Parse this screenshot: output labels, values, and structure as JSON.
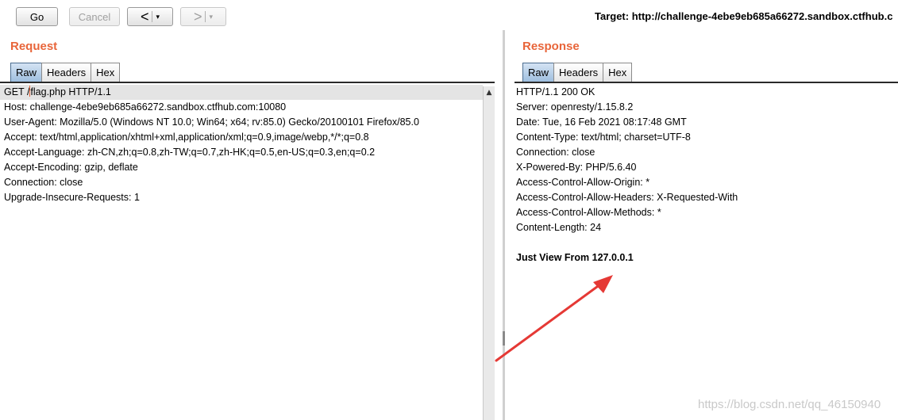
{
  "toolbar": {
    "go_label": "Go",
    "cancel_label": "Cancel",
    "back_glyph": "<",
    "forward_glyph": ">",
    "dropdown_glyph": "▾",
    "target_text": "Target: http://challenge-4ebe9eb685a66272.sandbox.ctfhub.c"
  },
  "request": {
    "title": "Request",
    "tabs": [
      "Raw",
      "Headers",
      "Hex"
    ],
    "active_tab": "Raw",
    "first_line_prefix": "GET /",
    "first_line_suffix": "flag.php HTTP/1.1",
    "lines": [
      "Host: challenge-4ebe9eb685a66272.sandbox.ctfhub.com:10080",
      "User-Agent: Mozilla/5.0 (Windows NT 10.0; Win64; x64; rv:85.0) Gecko/20100101 Firefox/85.0",
      "Accept: text/html,application/xhtml+xml,application/xml;q=0.9,image/webp,*/*;q=0.8",
      "Accept-Language: zh-CN,zh;q=0.8,zh-TW;q=0.7,zh-HK;q=0.5,en-US;q=0.3,en;q=0.2",
      "Accept-Encoding: gzip, deflate",
      "Connection: close",
      "Upgrade-Insecure-Requests: 1"
    ]
  },
  "response": {
    "title": "Response",
    "tabs": [
      "Raw",
      "Headers",
      "Hex"
    ],
    "active_tab": "Raw",
    "lines": [
      "HTTP/1.1 200 OK",
      "Server: openresty/1.15.8.2",
      "Date: Tue, 16 Feb 2021 08:17:48 GMT",
      "Content-Type: text/html; charset=UTF-8",
      "Connection: close",
      "X-Powered-By: PHP/5.6.40",
      "Access-Control-Allow-Origin: *",
      "Access-Control-Allow-Headers: X-Requested-With",
      "Access-Control-Allow-Methods: *",
      "Content-Length: 24"
    ],
    "body": "Just View From 127.0.0.1"
  },
  "watermark": "https://blog.csdn.net/qq_46150940",
  "colors": {
    "accent": "#e8653a",
    "annotation_arrow": "#e53935",
    "active_tab": "#9fbfdf"
  }
}
